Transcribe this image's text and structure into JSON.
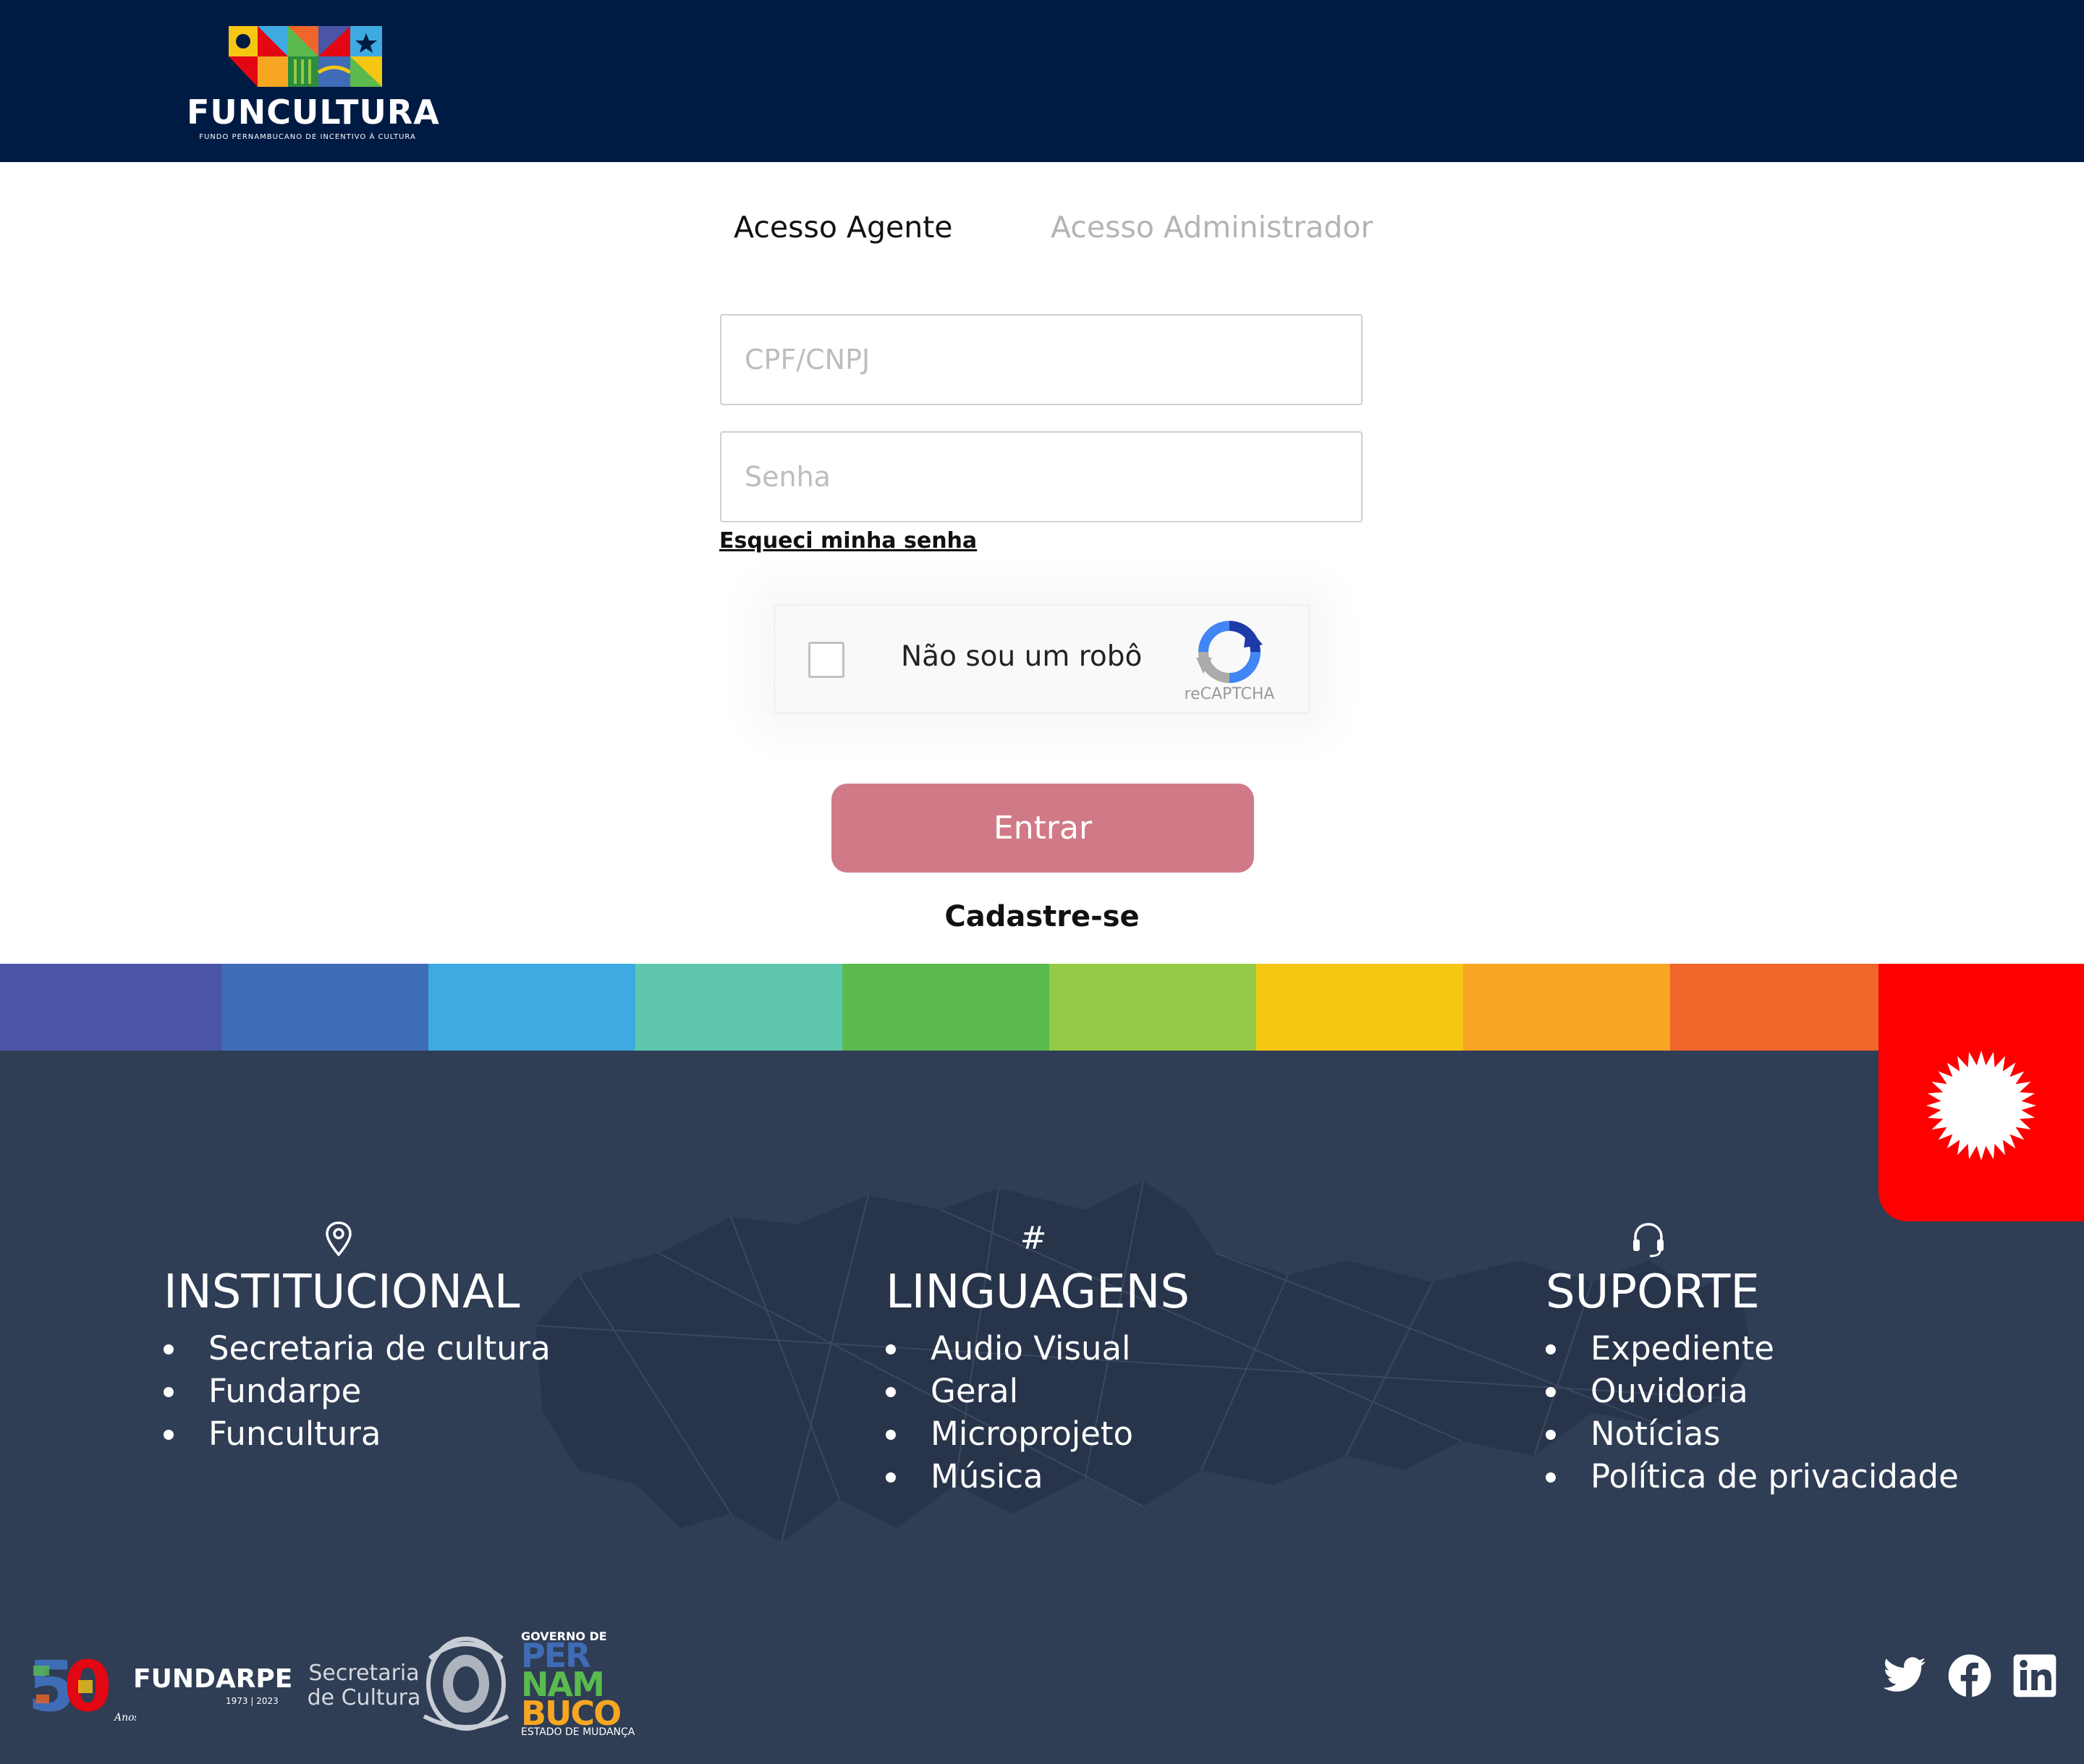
{
  "header": {
    "logo_text": "FUNCULTURA",
    "logo_subtitle": "FUNDO PERNAMBUCANO DE INCENTIVO À CULTURA"
  },
  "tabs": [
    {
      "label": "Acesso Agente",
      "active": true
    },
    {
      "label": "Acesso Administrador",
      "active": false
    }
  ],
  "form": {
    "cpf_placeholder": "CPF/CNPJ",
    "cpf_value": "",
    "senha_placeholder": "Senha",
    "senha_value": "",
    "forgot_label": "Esqueci minha senha",
    "recaptcha_label": "Não sou um robô",
    "recaptcha_brand": "reCAPTCHA",
    "submit_label": "Entrar",
    "register_label": "Cadastre-se"
  },
  "colors": {
    "header_bg": "#001b43",
    "footer_bg": "#2f3d55",
    "button_bg": "#d17a87",
    "badge_bg": "#ff0000",
    "rainbow": [
      "#4a55a5",
      "#3f6cb6",
      "#3dabe1",
      "#5fc7ae",
      "#5aba4e",
      "#94ca46",
      "#f5c713",
      "#f6a623",
      "#f06529"
    ]
  },
  "footer": {
    "institucional": {
      "title": "INSTITUCIONAL",
      "icon": "map-pin-icon",
      "items": [
        "Secretaria de cultura",
        "Fundarpe",
        "Funcultura"
      ]
    },
    "linguagens": {
      "title": "LINGUAGENS",
      "icon": "#",
      "items": [
        "Audio Visual",
        "Geral",
        "Microprojeto",
        "Música"
      ]
    },
    "suporte": {
      "title": "SUPORTE",
      "icon": "headset-icon",
      "items": [
        "Expediente",
        "Ouvidoria",
        "Notícias",
        "Política de privacidade"
      ]
    },
    "logos": {
      "fundarpe": "FUNDARPE",
      "fundarpe_years": "1973 | 2023",
      "fundarpe_anos": "Anos",
      "secretaria": "Secretaria de Cultura",
      "gov_label": "GOVERNO DE",
      "gov_line1": "PER",
      "gov_line2": "NAM",
      "gov_line3": "BUCO",
      "gov_state": "ESTADO DE MUDANÇA"
    },
    "social": [
      "twitter-icon",
      "facebook-icon",
      "linkedin-icon"
    ]
  }
}
